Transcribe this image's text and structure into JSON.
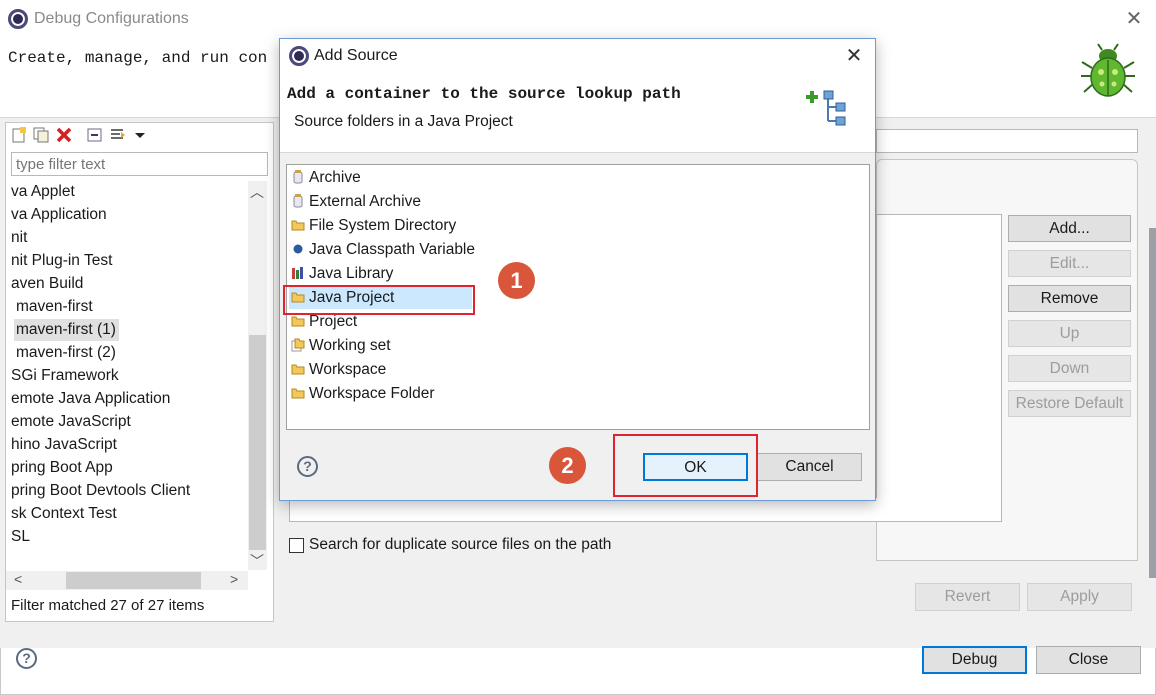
{
  "main_window": {
    "title": "Debug Configurations",
    "subtitle": "Create, manage, and run con",
    "close_glyph": "✕",
    "icon": "eclipse-icon",
    "header_icon": "bug-icon"
  },
  "left_panel": {
    "toolbar_icons": [
      "new-configuration-icon",
      "duplicate-icon",
      "delete-icon",
      "collapse-all-icon",
      "filter-icon",
      "dropdown-arrow-icon"
    ],
    "filter_placeholder": "type filter text",
    "items": [
      {
        "label": "va Applet"
      },
      {
        "label": "va Application"
      },
      {
        "label": "nit"
      },
      {
        "label": "nit Plug-in Test"
      },
      {
        "label": "aven Build"
      },
      {
        "label": "maven-first"
      },
      {
        "label": "maven-first (1)",
        "selected": true
      },
      {
        "label": "maven-first (2)"
      },
      {
        "label": "SGi Framework"
      },
      {
        "label": "emote Java Application"
      },
      {
        "label": "emote JavaScript"
      },
      {
        "label": "hino JavaScript"
      },
      {
        "label": "pring Boot App"
      },
      {
        "label": "pring Boot Devtools Client"
      },
      {
        "label": "sk Context Test"
      },
      {
        "label": "SL"
      }
    ],
    "scroll_up_glyph": "︿",
    "scroll_down_glyph": "﹀",
    "scroll_left_glyph": "<",
    "scroll_right_glyph": ">",
    "status": "Filter matched 27 of 27 items"
  },
  "right_panel": {
    "side_buttons": [
      {
        "label": "Add...",
        "enabled": true
      },
      {
        "label": "Edit...",
        "enabled": false
      },
      {
        "label": "Remove",
        "enabled": true
      },
      {
        "label": "Up",
        "enabled": false
      },
      {
        "label": "Down",
        "enabled": false
      },
      {
        "label": "Restore Default",
        "enabled": false
      }
    ],
    "duplicate_checkbox_label": "Search for duplicate source files on the path",
    "duplicate_checked": false,
    "revert_label": "Revert",
    "apply_label": "Apply",
    "debug_label": "Debug",
    "close_label": "Close",
    "help_glyph": "?"
  },
  "dialog": {
    "title": "Add Source",
    "close_glyph": "✕",
    "heading": "Add a container to the source lookup path",
    "description": "Source folders in a Java Project",
    "items": [
      {
        "label": "Archive",
        "icon": "jar-icon"
      },
      {
        "label": "External Archive",
        "icon": "jar-icon"
      },
      {
        "label": "File System Directory",
        "icon": "folder-icon"
      },
      {
        "label": "Java Classpath Variable",
        "icon": "variable-dot-icon"
      },
      {
        "label": "Java Library",
        "icon": "library-icon"
      },
      {
        "label": "Java Project",
        "icon": "folder-icon",
        "selected": true
      },
      {
        "label": "Project",
        "icon": "folder-icon"
      },
      {
        "label": "Working set",
        "icon": "working-set-icon"
      },
      {
        "label": "Workspace",
        "icon": "folder-icon"
      },
      {
        "label": "Workspace Folder",
        "icon": "folder-icon"
      }
    ],
    "ok_label": "OK",
    "cancel_label": "Cancel",
    "help_glyph": "?"
  },
  "annotations": {
    "step1": "1",
    "step2": "2",
    "highlight_color": "#e0232e",
    "badge_color": "#d9563b"
  },
  "colors": {
    "accent": "#0078d7",
    "selection": "#cce8ff"
  }
}
